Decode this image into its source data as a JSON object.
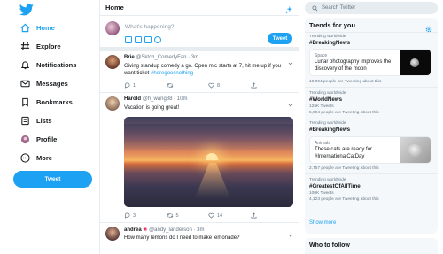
{
  "nav": {
    "items": [
      {
        "label": "Home",
        "icon": "home-icon"
      },
      {
        "label": "Explore",
        "icon": "hashtag-icon"
      },
      {
        "label": "Notifications",
        "icon": "bell-icon"
      },
      {
        "label": "Messages",
        "icon": "envelope-icon"
      },
      {
        "label": "Bookmarks",
        "icon": "bookmark-icon"
      },
      {
        "label": "Lists",
        "icon": "list-icon"
      },
      {
        "label": "Profile",
        "icon": "avatar-icon"
      },
      {
        "label": "More",
        "icon": "more-icon"
      }
    ],
    "tweet_button": "Tweet"
  },
  "colors": {
    "accent": "#1da1f2",
    "text": "#14171a",
    "muted": "#657786",
    "border": "#e6ecf0"
  },
  "main": {
    "title": "Home",
    "composer": {
      "placeholder": "What's happening?",
      "button": "Tweet"
    },
    "tweets": [
      {
        "name": "Brie",
        "handle": "@Sktch_ComedyFan · 3m",
        "text": "Giving standup comedy a go. Open mic starts at 7, hit me up if you want ticket ",
        "hashtag": "#heregoesnothing",
        "reply": "1",
        "retweet": "",
        "like": "8"
      },
      {
        "name": "Harold",
        "handle": "@h_wang88 · 10m",
        "text": "Vacation is going great!",
        "reply": "3",
        "retweet": "5",
        "like": "14"
      },
      {
        "name": "andrea",
        "handle": "@andy_landerson · 3m",
        "text": "How many lemons do I need to make lemonade?"
      }
    ]
  },
  "search": {
    "placeholder": "Search Twitter"
  },
  "trends": {
    "title": "Trends for you",
    "items": [
      {
        "sub": "Trending worldwide",
        "name": "#BreakingNews"
      },
      {
        "card_tag": "Space",
        "card_text": "Lunar photography improves the discovery of the moon",
        "count": "10,094 people are Tweeting about this"
      },
      {
        "sub": "Trending worldwide",
        "name": "#WorldNews",
        "tweets": "125K Tweets",
        "count": "5,094 people are Tweeting about this"
      },
      {
        "sub": "Trending worldwide",
        "name": "#BreakingNews"
      },
      {
        "card_tag": "Animals",
        "card_text": "These cats are ready for #InternationalCatDay",
        "count": "2,757 people are Tweeting about this"
      },
      {
        "sub": "Trending worldwide",
        "name": "#GreatestOfAllTime",
        "tweets": "100K Tweets",
        "count": "4,123 people are Tweeting about this"
      }
    ],
    "show_more": "Show more"
  },
  "who_to_follow": {
    "title": "Who to follow"
  }
}
